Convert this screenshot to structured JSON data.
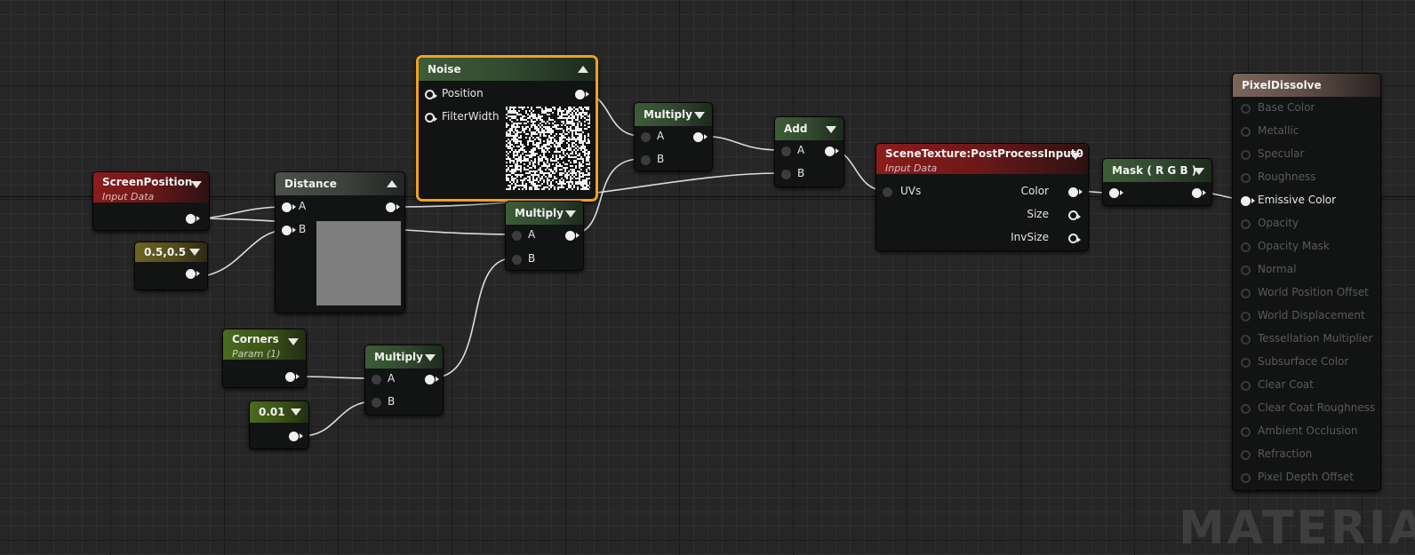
{
  "nodes": {
    "screen_position": {
      "title": "ScreenPosition",
      "subtitle": "Input Data"
    },
    "const_05": {
      "title": "0.5,0.5"
    },
    "distance": {
      "title": "Distance",
      "pin_a": "A",
      "pin_b": "B"
    },
    "noise": {
      "title": "Noise",
      "pin_position": "Position",
      "pin_filterwidth": "FilterWidth"
    },
    "multiply_top": {
      "title": "Multiply",
      "pin_a": "A",
      "pin_b": "B"
    },
    "multiply_mid": {
      "title": "Multiply",
      "pin_a": "A",
      "pin_b": "B"
    },
    "multiply_low": {
      "title": "Multiply",
      "pin_a": "A",
      "pin_b": "B"
    },
    "add": {
      "title": "Add",
      "pin_a": "A",
      "pin_b": "B"
    },
    "corners": {
      "title": "Corners",
      "subtitle": "Param (1)"
    },
    "const_001": {
      "title": "0.01"
    },
    "scene_texture": {
      "title": "SceneTexture:PostProcessInput0",
      "subtitle": "Input Data",
      "pin_uvs": "UVs",
      "out_color": "Color",
      "out_size": "Size",
      "out_invsize": "InvSize"
    },
    "mask": {
      "title": "Mask ( R G B )"
    },
    "result": {
      "title": "PixelDissolve",
      "pins": [
        "Base Color",
        "Metallic",
        "Specular",
        "Roughness",
        "Emissive Color",
        "Opacity",
        "Opacity Mask",
        "Normal",
        "World Position Offset",
        "World Displacement",
        "Tessellation Multiplier",
        "Subsurface Color",
        "Clear Coat",
        "Clear Coat Roughness",
        "Ambient Occlusion",
        "Refraction",
        "Pixel Depth Offset"
      ],
      "active_pin": "Emissive Color"
    }
  },
  "watermark": "MATERIAL",
  "colors": {
    "selected_outline": "#f0a020",
    "wire": "#e0e0e0",
    "background": "#262626"
  }
}
